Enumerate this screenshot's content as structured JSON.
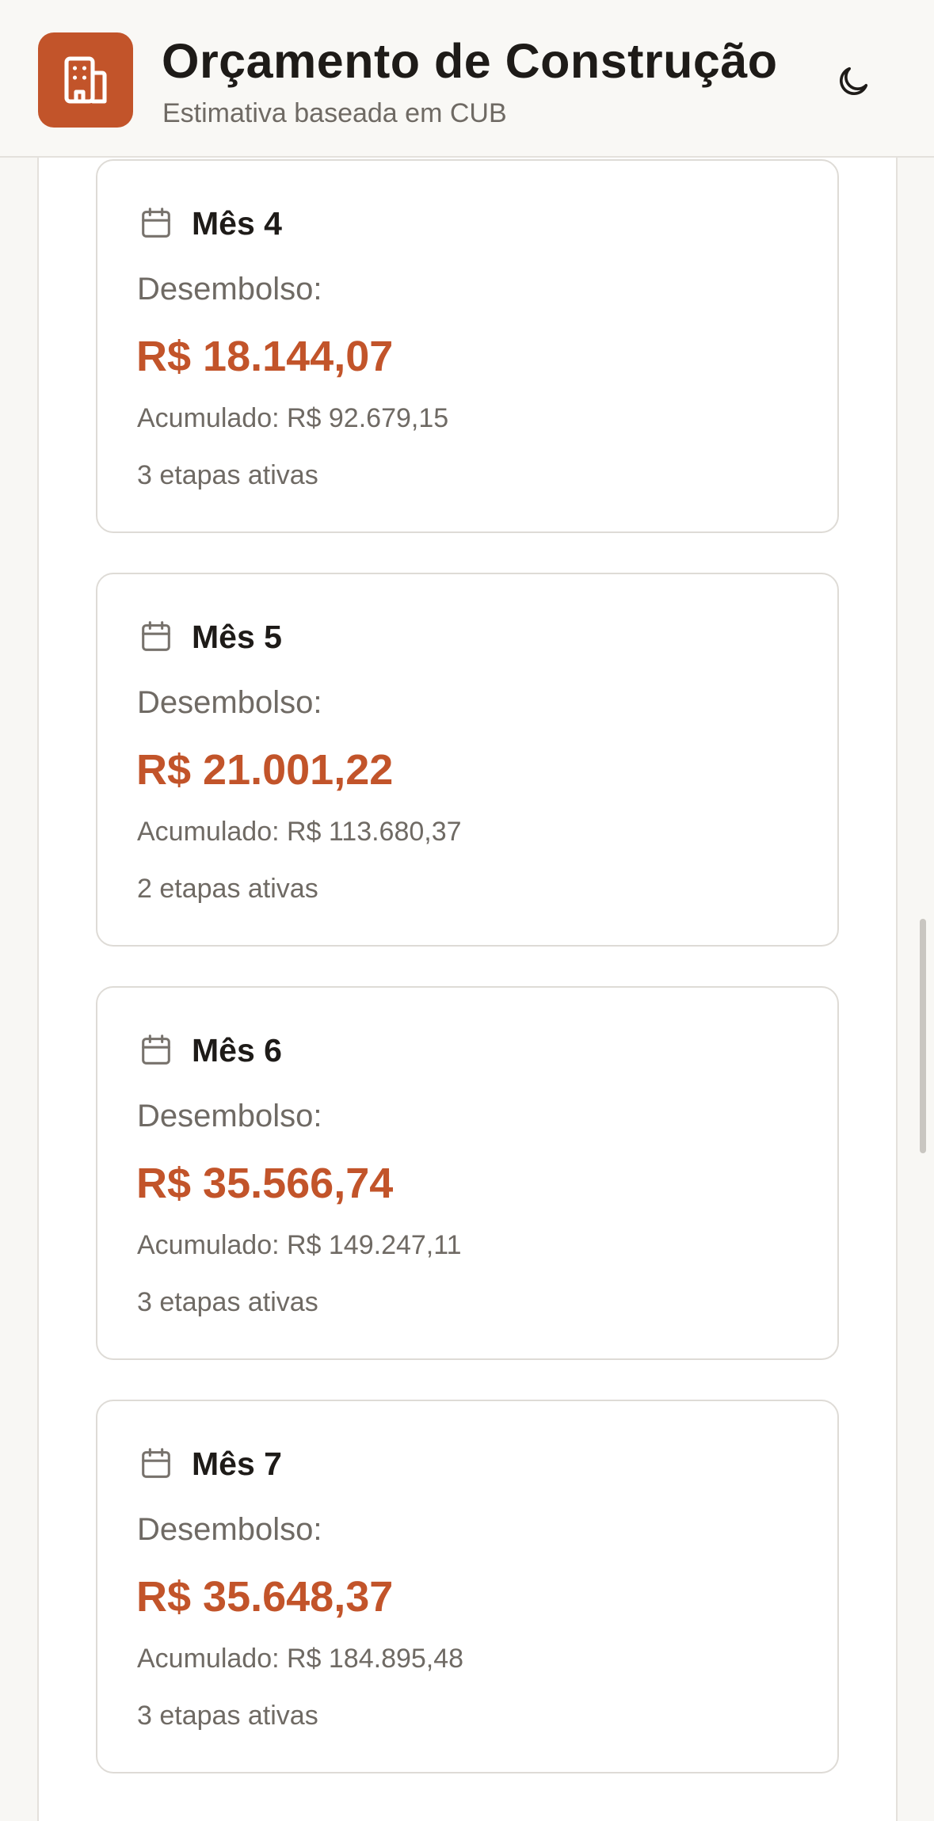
{
  "header": {
    "title": "Orçamento de Construção",
    "subtitle": "Estimativa baseada em CUB",
    "logo_icon": "building-icon",
    "theme_icon": "moon-icon"
  },
  "colors": {
    "accent": "#c2542a",
    "text": "#1e1b18",
    "muted": "#6f6a64",
    "background": "#f8f7f4"
  },
  "schedule": {
    "cards": [
      {
        "month": "Mês 4",
        "disbursement_label": "Desembolso:",
        "disbursement": "R$ 18.144,07",
        "accumulated": "Acumulado: R$ 92.679,15",
        "stages": "3 etapas ativas"
      },
      {
        "month": "Mês 5",
        "disbursement_label": "Desembolso:",
        "disbursement": "R$ 21.001,22",
        "accumulated": "Acumulado: R$ 113.680,37",
        "stages": "2 etapas ativas"
      },
      {
        "month": "Mês 6",
        "disbursement_label": "Desembolso:",
        "disbursement": "R$ 35.566,74",
        "accumulated": "Acumulado: R$ 149.247,11",
        "stages": "3 etapas ativas"
      },
      {
        "month": "Mês 7",
        "disbursement_label": "Desembolso:",
        "disbursement": "R$ 35.648,37",
        "accumulated": "Acumulado: R$ 184.895,48",
        "stages": "3 etapas ativas"
      }
    ]
  }
}
